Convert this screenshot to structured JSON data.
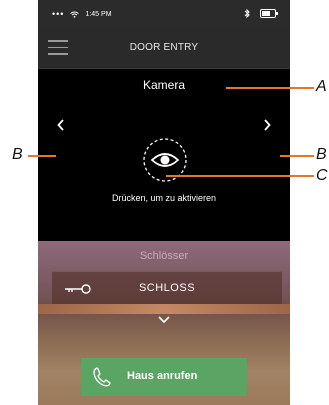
{
  "status_bar": {
    "time": "1:45 PM"
  },
  "header": {
    "title": "DOOR ENTRY"
  },
  "camera": {
    "label": "Kamera",
    "activate_text": "Drücken, um zu aktivieren"
  },
  "locks": {
    "section_title": "Schlösser",
    "items": [
      {
        "label": "SCHLOSS"
      }
    ]
  },
  "call_button": {
    "label": "Haus anrufen"
  },
  "callouts": {
    "a": "A",
    "b_left": "B",
    "b_right": "B",
    "c": "C"
  },
  "colors": {
    "callout": "#e4782a",
    "call_button": "#5aa563"
  }
}
